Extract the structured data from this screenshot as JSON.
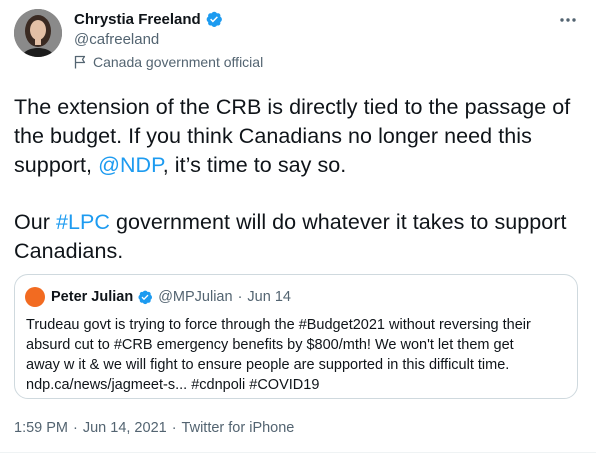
{
  "author": {
    "display_name": "Chrystia Freeland",
    "handle": "@cafreeland",
    "label": "Canada government official",
    "verified": true
  },
  "tweet": {
    "para1_a": "The extension of the CRB is directly tied to the passage of the budget. If you think Canadians no longer need this support, ",
    "para1_mention": "@NDP",
    "para1_b": ", it’s time to say so.",
    "para2_a": "Our ",
    "para2_hashtag": "#LPC",
    "para2_b": " government will do whatever it takes to support Canadians."
  },
  "quoted_tweet": {
    "display_name": "Peter Julian",
    "handle": "@MPJulian",
    "separator": "·",
    "date": "Jun 14",
    "text_line1": "Trudeau govt is trying to force through the #Budget2021 without reversing their",
    "text_line2": "absurd cut to #CRB emergency benefits by $800/mth! We won't let them get",
    "text_line3": "away w it & we will fight to ensure people are supported in this difficult time.",
    "text_line4": "ndp.ca/news/jagmeet-s... #cdnpoli #COVID19",
    "avatar_color": "#f26b21"
  },
  "meta": {
    "time": "1:59 PM",
    "separator": "·",
    "date": "Jun 14, 2021",
    "source": "Twitter for iPhone"
  },
  "icons": {
    "verified": "verified-badge-icon",
    "more": "more-options-icon",
    "flag": "flag-icon"
  },
  "colors": {
    "accent": "#1d9bf0",
    "text": "#0f1419",
    "secondary": "#536471",
    "border": "#cfd9de"
  }
}
